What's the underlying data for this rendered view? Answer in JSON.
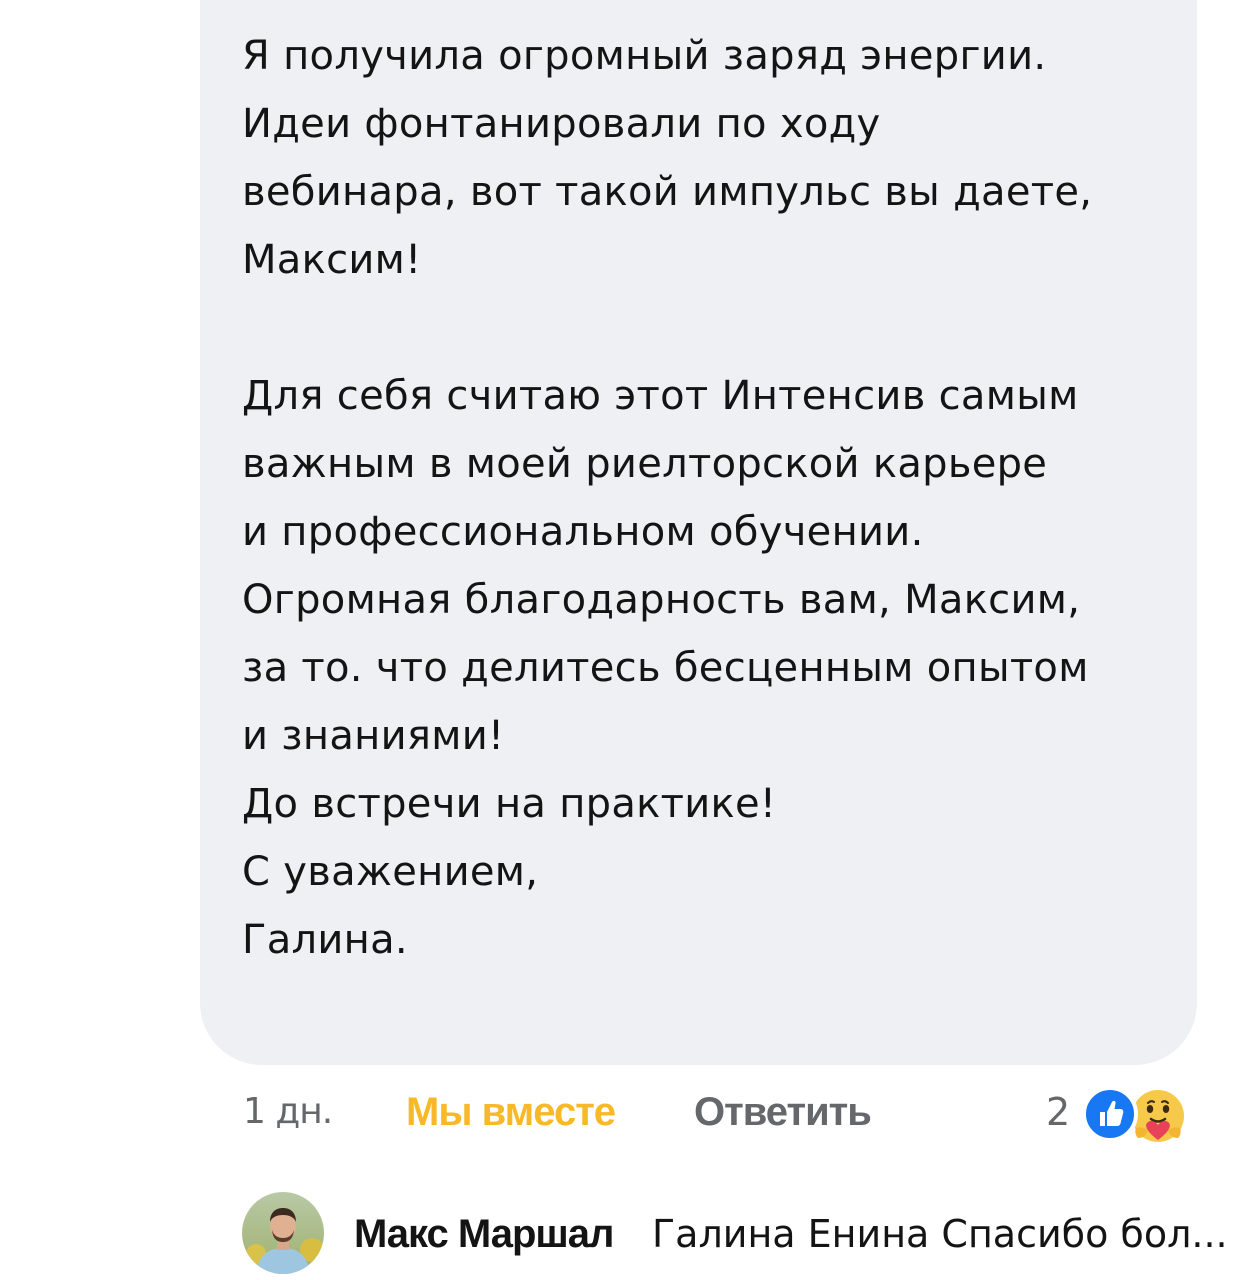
{
  "comment": {
    "paragraphs": [
      [
        "Я получила огромный заряд энергии.",
        "Идеи фонтанировали по ходу",
        "вебинара, вот такой импульс вы даете,",
        "Максим!"
      ],
      [
        "Для себя считаю этот Интенсив самым",
        "важным в моей риелторской карьере",
        "и профессиональном обучении.",
        "Огромная благодарность вам, Максим,",
        "за то. что делитесь бесценным опытом",
        "и знаниями!",
        "До встречи на практике!",
        "С уважением,",
        "Галина."
      ]
    ],
    "bubble_color": "#eff0f4"
  },
  "actions": {
    "timestamp": "1 дн.",
    "reaction_label": "Мы вместе",
    "reaction_color": "#f7b928",
    "reply_label": "Ответить",
    "reaction_count": "2",
    "reaction_icons": [
      "like-icon",
      "care-icon"
    ],
    "like_color": "#1877f2"
  },
  "reply": {
    "author": "Макс Маршал",
    "preview": "Галина Енина Спасибо бол..."
  }
}
